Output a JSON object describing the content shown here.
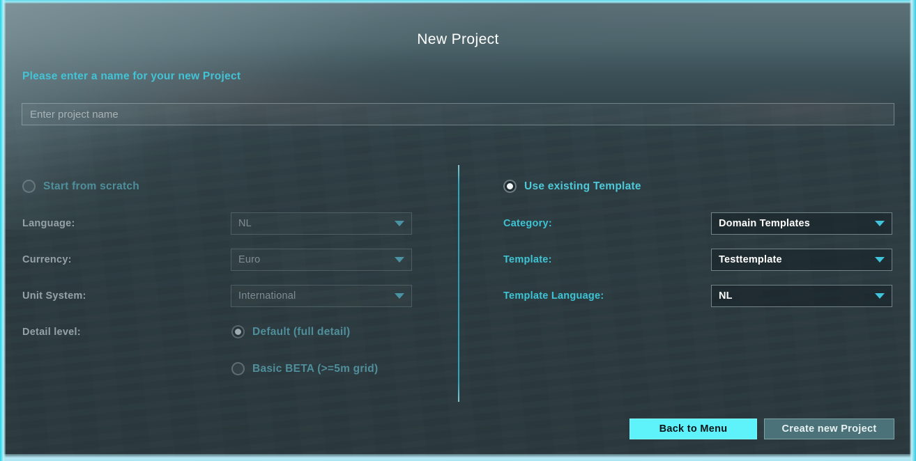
{
  "dialog": {
    "title": "New Project",
    "prompt_label": "Please enter a name for your new Project"
  },
  "project_name": {
    "value": "",
    "placeholder": "Enter project name"
  },
  "scratch": {
    "radio_label": "Start from scratch",
    "selected": false,
    "fields": [
      {
        "label": "Language:",
        "value": "NL"
      },
      {
        "label": "Currency:",
        "value": "Euro"
      },
      {
        "label": "Unit System:",
        "value": "International"
      }
    ],
    "detail": {
      "label": "Detail level:",
      "options": [
        {
          "label": "Default (full detail)",
          "selected": true
        },
        {
          "label": "Basic BETA (>=5m grid)",
          "selected": false
        }
      ]
    }
  },
  "template": {
    "radio_label": "Use existing Template",
    "selected": true,
    "fields": [
      {
        "label": "Category:",
        "value": "Domain Templates"
      },
      {
        "label": "Template:",
        "value": "Testtemplate"
      },
      {
        "label": "Template Language:",
        "value": "NL"
      }
    ]
  },
  "actions": {
    "back_label": "Back to Menu",
    "create_label": "Create new Project"
  },
  "colors": {
    "accent_cyan": "#3ec4d4",
    "frame_glow": "#6de4f2",
    "button_primary": "#5ef2fb",
    "button_secondary": "#4a7278",
    "panel_bg": "#2d3b40"
  }
}
